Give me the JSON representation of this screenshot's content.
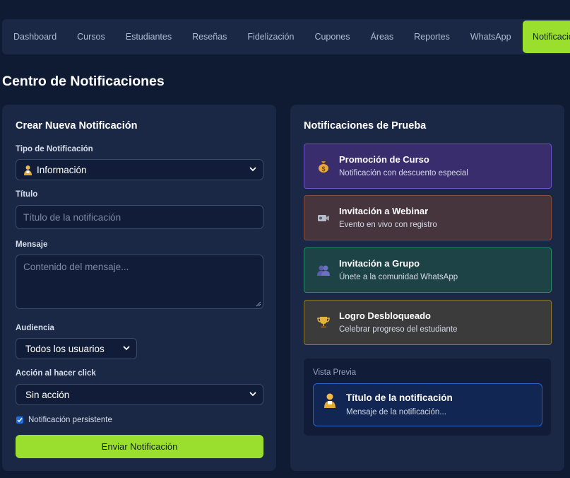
{
  "nav": {
    "items": [
      "Dashboard",
      "Cursos",
      "Estudiantes",
      "Reseñas",
      "Fidelización",
      "Cupones",
      "Áreas",
      "Reportes",
      "WhatsApp",
      "Notificaciones"
    ],
    "active": "Notificaciones"
  },
  "page_title": "Centro de Notificaciones",
  "create": {
    "title": "Crear Nueva Notificación",
    "type_label": "Tipo de Notificación",
    "type_value": "Información",
    "title_label": "Título",
    "title_placeholder": "Título de la notificación",
    "message_label": "Mensaje",
    "message_placeholder": "Contenido del mensaje...",
    "audience_label": "Audiencia",
    "audience_value": "Todos los usuarios",
    "action_label": "Acción al hacer click",
    "action_value": "Sin acción",
    "persistent_label": "Notificación persistente",
    "persistent_checked": true,
    "send_label": "Enviar Notificación"
  },
  "tests": {
    "title": "Notificaciones de Prueba",
    "items": [
      {
        "title": "Promoción de Curso",
        "subtitle": "Notificación con descuento especial",
        "icon": "money-bag-icon",
        "bg": "#3a2d6d",
        "border": "#6d52c9"
      },
      {
        "title": "Invitación a Webinar",
        "subtitle": "Evento en vivo con registro",
        "icon": "video-camera-icon",
        "bg": "#46353d",
        "border": "#8a4c3a"
      },
      {
        "title": "Invitación a Grupo",
        "subtitle": "Únete a la comunidad WhatsApp",
        "icon": "group-icon",
        "bg": "#1d4346",
        "border": "#2b8a6a"
      },
      {
        "title": "Logro Desbloqueado",
        "subtitle": "Celebrar progreso del estudiante",
        "icon": "trophy-icon",
        "bg": "#3c3b3b",
        "border": "#8d7a2e"
      }
    ]
  },
  "preview": {
    "label": "Vista Previa",
    "title": "Título de la notificación",
    "message": "Mensaje de la notificación..."
  },
  "colors": {
    "accent": "#9ade2e",
    "background": "#0f1a33",
    "card": "#1a2745"
  }
}
